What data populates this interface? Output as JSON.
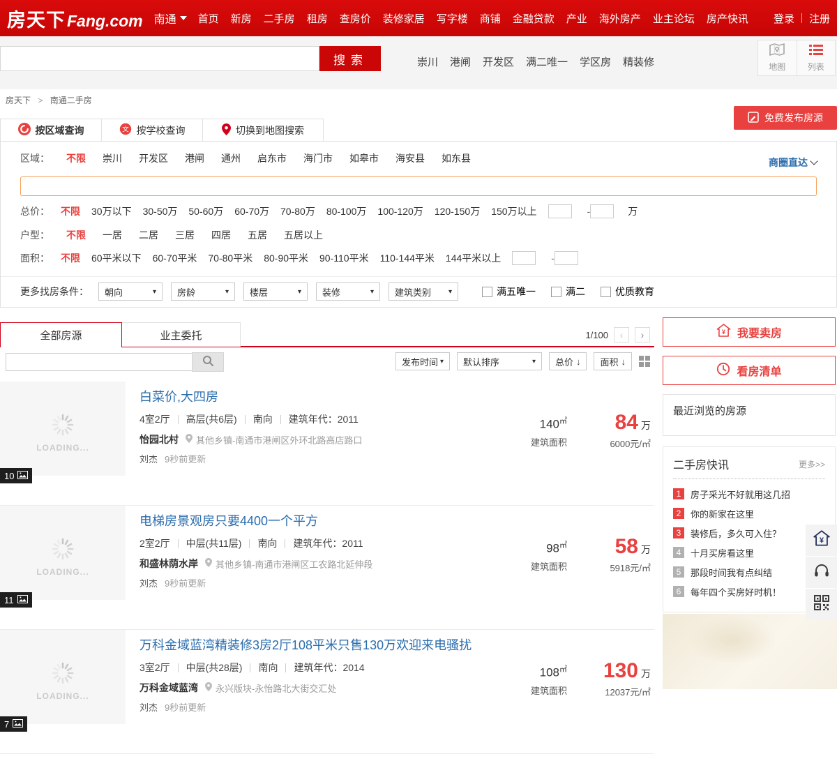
{
  "topnav": {
    "logo_cn": "房天下",
    "logo_en": "Fang.com",
    "city": "南通",
    "items": [
      "首页",
      "新房",
      "二手房",
      "租房",
      "查房价",
      "装修家居",
      "写字楼",
      "商铺",
      "金融贷款",
      "产业",
      "海外房产",
      "业主论坛",
      "房产快讯"
    ],
    "login": "登录",
    "register": "注册"
  },
  "search": {
    "button": "搜索",
    "quick_links": [
      "崇川",
      "港闸",
      "开发区",
      "满二唯一",
      "学区房",
      "精装修"
    ],
    "map_label": "地图",
    "list_label": "列表"
  },
  "breadcrumb": {
    "home": "房天下",
    "current": "南通二手房"
  },
  "publish": {
    "label": "免费发布房源"
  },
  "query_tabs": {
    "by_region": "按区域查询",
    "by_school": "按学校查询",
    "to_map": "切换到地图搜索"
  },
  "filters": {
    "region_label": "区域：",
    "region_options": [
      "不限",
      "崇川",
      "开发区",
      "港闸",
      "通州",
      "启东市",
      "海门市",
      "如皋市",
      "海安县",
      "如东县"
    ],
    "biz_circle": "商圈直达",
    "price_label": "总价：",
    "price_options": [
      "不限",
      "30万以下",
      "30-50万",
      "50-60万",
      "60-70万",
      "70-80万",
      "80-100万",
      "100-120万",
      "120-150万",
      "150万以上"
    ],
    "price_unit": "万",
    "layout_label": "户型：",
    "layout_options": [
      "不限",
      "一居",
      "二居",
      "三居",
      "四居",
      "五居",
      "五居以上"
    ],
    "area_label": "面积：",
    "area_options": [
      "不限",
      "60平米以下",
      "60-70平米",
      "70-80平米",
      "80-90平米",
      "90-110平米",
      "110-144平米",
      "144平米以上"
    ],
    "more_label": "更多找房条件：",
    "dropdowns": [
      "朝向",
      "房龄",
      "楼层",
      "装修",
      "建筑类别"
    ],
    "checkboxes": [
      "满五唯一",
      "满二",
      "优质教育"
    ]
  },
  "list_header": {
    "tab_all": "全部房源",
    "tab_owner": "业主委托",
    "page": "1/100",
    "sort_time": "发布时间",
    "sort_default": "默认排序",
    "sort_price": "总价",
    "sort_area": "面积"
  },
  "loading_text": "LOADING...",
  "listings": [
    {
      "photos": "10",
      "title": "白菜价,大四房",
      "rooms": "4室2厅",
      "floor": "高层(共6层)",
      "orient": "南向",
      "year": "建筑年代：2011",
      "community": "怡园北村",
      "address": "其他乡镇-南通市港闸区外环北路高店路口",
      "agent": "刘杰",
      "updated": "9秒前更新",
      "area_value": "140",
      "area_unit": "㎡",
      "area_label": "建筑面积",
      "price": "84",
      "price_unit": "万",
      "unit_price": "6000元/㎡"
    },
    {
      "photos": "11",
      "title": "电梯房景观房只要4400一个平方",
      "rooms": "2室2厅",
      "floor": "中层(共11层)",
      "orient": "南向",
      "year": "建筑年代：2011",
      "community": "和盛林荫水岸",
      "address": "其他乡镇-南通市港闸区工农路北延伸段",
      "agent": "刘杰",
      "updated": "9秒前更新",
      "area_value": "98",
      "area_unit": "㎡",
      "area_label": "建筑面积",
      "price": "58",
      "price_unit": "万",
      "unit_price": "5918元/㎡"
    },
    {
      "photos": "7",
      "title": "万科金域蓝湾精装修3房2厅108平米只售130万欢迎来电骚扰",
      "rooms": "3室2厅",
      "floor": "中层(共28层)",
      "orient": "南向",
      "year": "建筑年代：2014",
      "community": "万科金域蓝湾",
      "address": "永兴版块-永怡路北大街交汇处",
      "agent": "刘杰",
      "updated": "9秒前更新",
      "area_value": "108",
      "area_unit": "㎡",
      "area_label": "建筑面积",
      "price": "130",
      "price_unit": "万",
      "unit_price": "12037元/㎡"
    }
  ],
  "sidebar": {
    "sell": "我要卖房",
    "watch": "看房清单",
    "recent_title": "最近浏览的房源",
    "news_title": "二手房快讯",
    "news_more": "更多>>",
    "news": [
      {
        "num": "1",
        "text": "房子采光不好就用这几招"
      },
      {
        "num": "2",
        "text": "你的新家在这里"
      },
      {
        "num": "3",
        "text": "装修后，多久可入住？"
      },
      {
        "num": "4",
        "text": "十月买房看这里"
      },
      {
        "num": "5",
        "text": "那段时间我有点纠结"
      },
      {
        "num": "6",
        "text": "每年四个买房好时机！"
      }
    ]
  },
  "colors": {
    "header_red": "#d20b0b",
    "accent_red": "#e8413f",
    "tab_red": "#d0021b",
    "title_blue": "#2a6dad",
    "orange_border": "#f7a25b"
  }
}
